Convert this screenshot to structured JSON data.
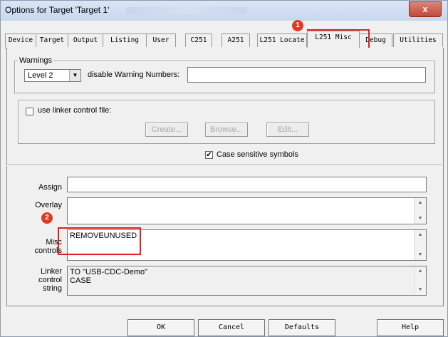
{
  "window": {
    "title": "Options for Target 'Target 1'",
    "close_glyph": "x"
  },
  "tabs": [
    {
      "label": "Device"
    },
    {
      "label": "Target"
    },
    {
      "label": "Output"
    },
    {
      "label": "Listing"
    },
    {
      "label": "User"
    },
    {
      "label": "C251"
    },
    {
      "label": "A251"
    },
    {
      "label": "L251 Locate"
    },
    {
      "label": "L251 Misc",
      "active": true
    },
    {
      "label": "Debug"
    },
    {
      "label": "Utilities"
    }
  ],
  "annotations": {
    "badge1": "1",
    "badge2": "2",
    "color": "#e02020"
  },
  "warnings": {
    "group_label": "Warnings",
    "level_value": "Level 2",
    "disable_label": "disable Warning Numbers:",
    "disable_value": ""
  },
  "linker_file": {
    "checkbox_label": "use linker control file:",
    "checked": false,
    "create_label": "Create...",
    "browse_label": "Browse...",
    "edit_label": "Edit..."
  },
  "case_sensitive": {
    "label": "Case sensitive symbols",
    "checked": true,
    "mark": "✔"
  },
  "fields": {
    "assign_label": "Assign",
    "assign_value": "",
    "overlay_label": "Overlay",
    "overlay_value": "",
    "misc_label_1": "Misc",
    "misc_label_2": "controls",
    "misc_value": "REMOVEUNUSED",
    "linker_label_1": "Linker",
    "linker_label_2": "control",
    "linker_label_3": "string",
    "linker_value": "TO \"USB-CDC-Demo\"\nCASE"
  },
  "buttons": {
    "ok": "OK",
    "cancel": "Cancel",
    "defaults": "Defaults",
    "help": "Help"
  },
  "icons": {
    "dropdown": "chevron-down-icon",
    "scroll_up": "scroll-up-icon",
    "scroll_down": "scroll-down-icon"
  }
}
